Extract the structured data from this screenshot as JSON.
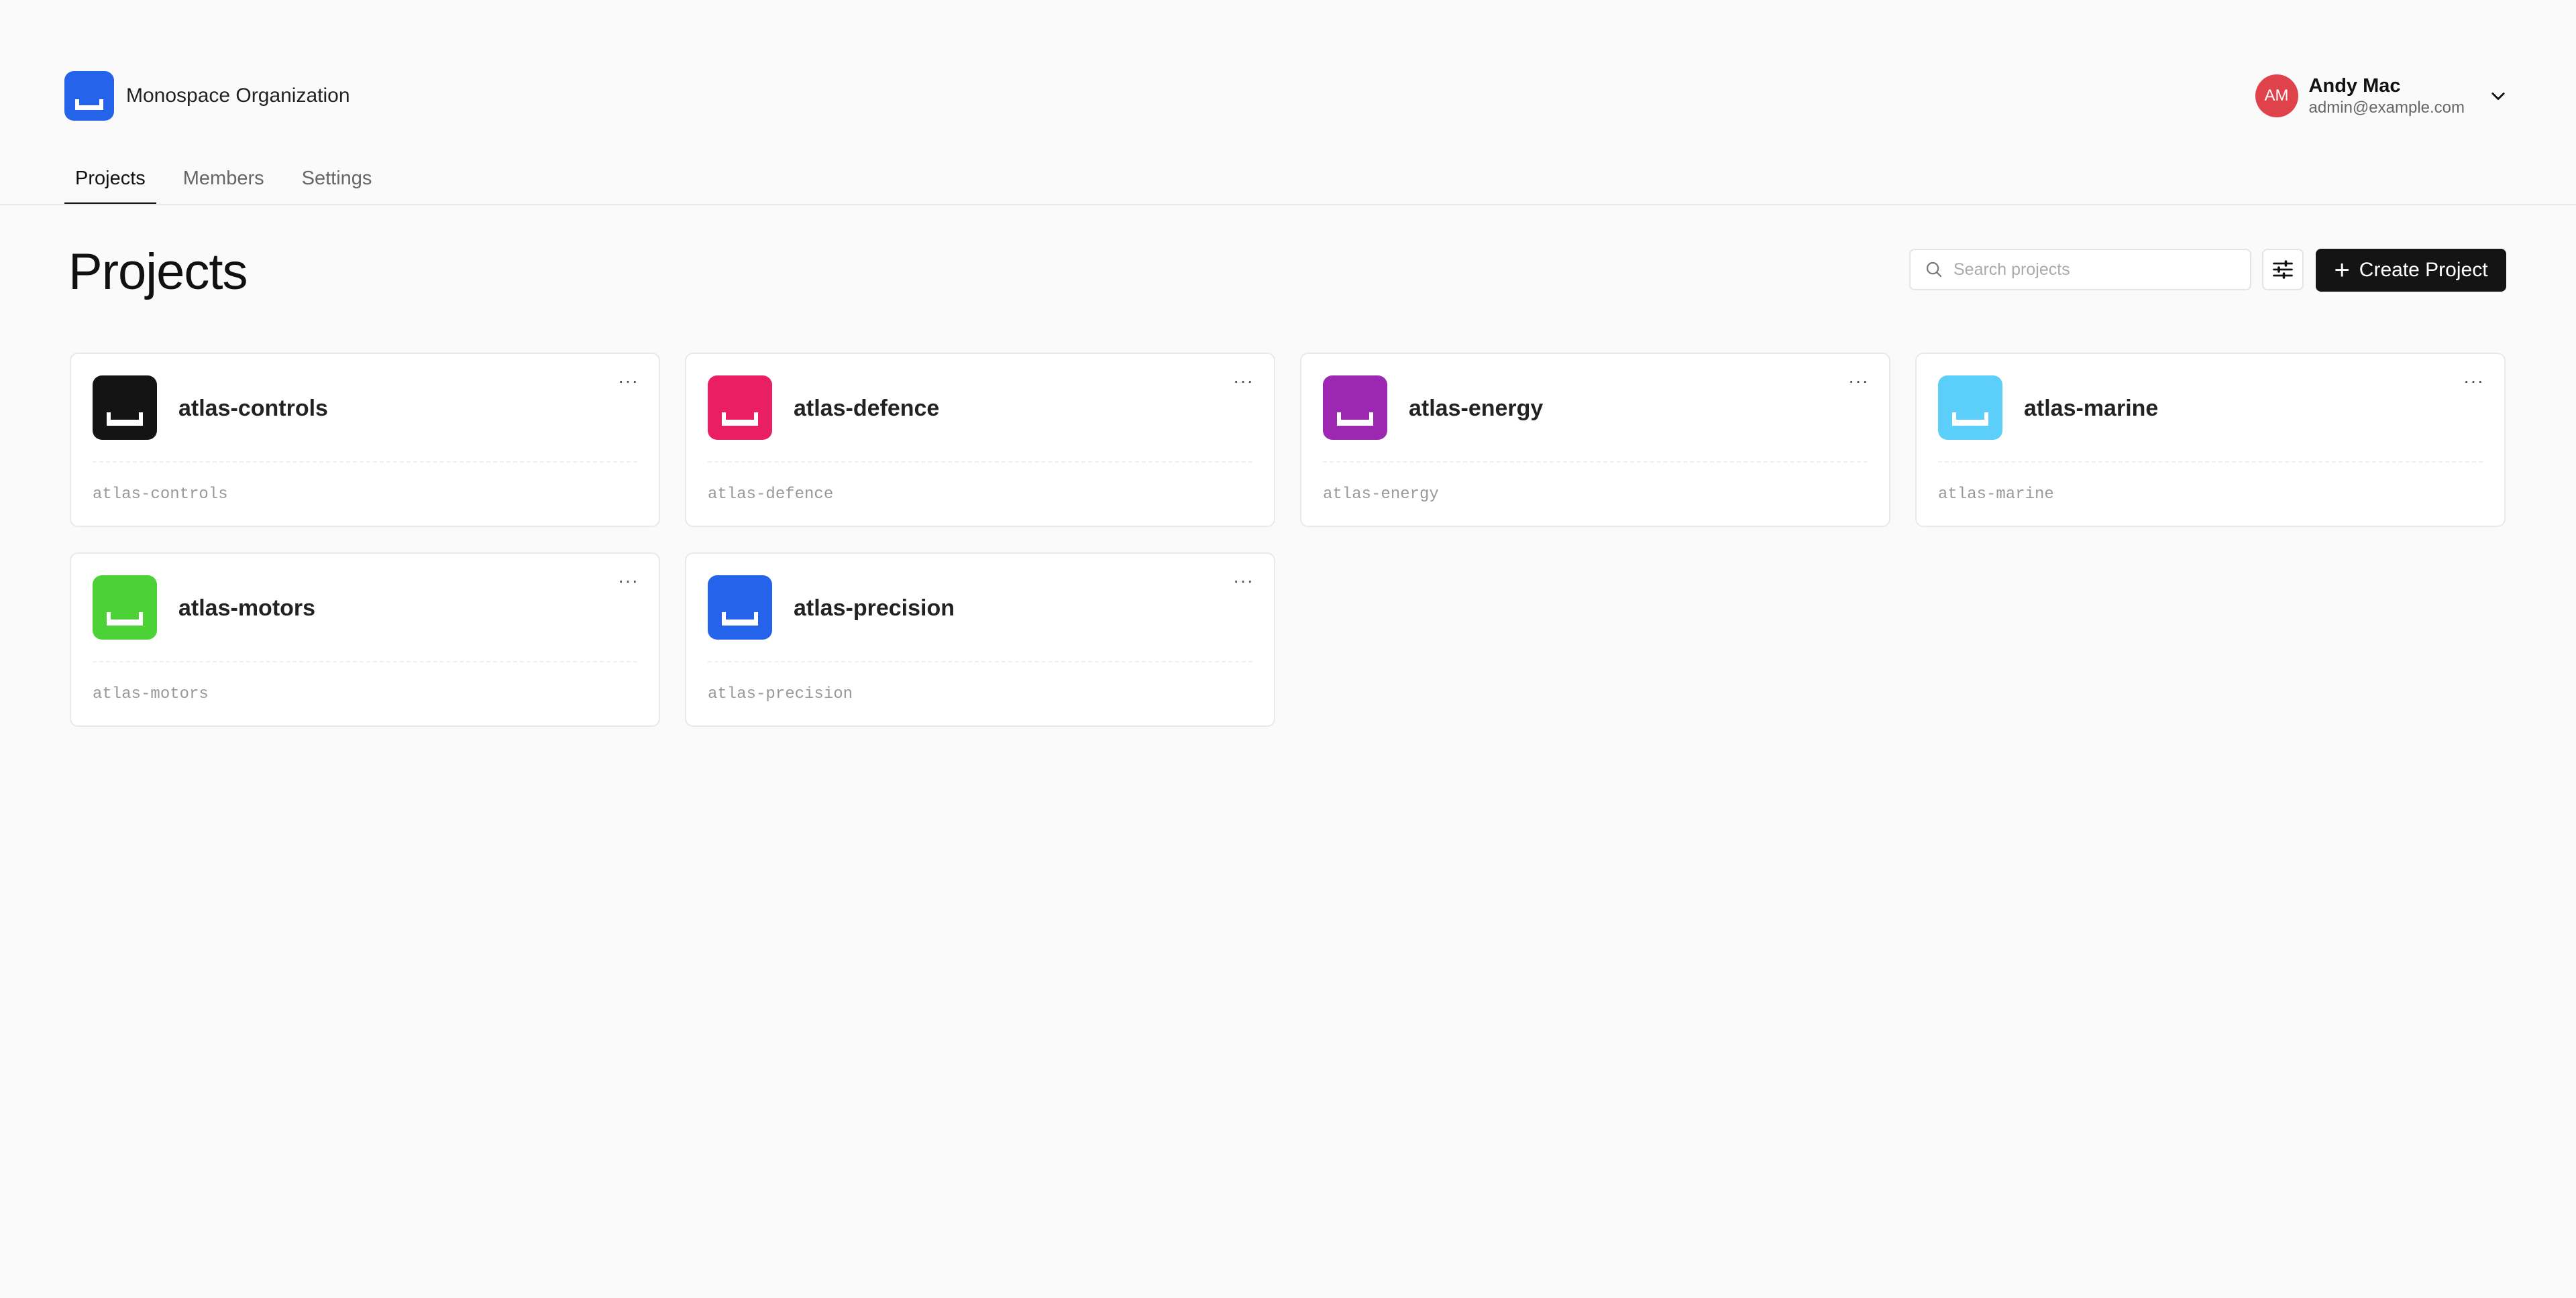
{
  "org": {
    "name": "Monospace Organization",
    "logo_color": "#2563eb",
    "logo_icon": "bracket-logo-icon"
  },
  "user": {
    "initials": "AM",
    "name": "Andy Mac",
    "email": "admin@example.com",
    "avatar_color": "#e0424b"
  },
  "tabs": [
    {
      "label": "Projects",
      "active": true
    },
    {
      "label": "Members",
      "active": false
    },
    {
      "label": "Settings",
      "active": false
    }
  ],
  "page": {
    "title": "Projects"
  },
  "search": {
    "placeholder": "Search projects",
    "value": ""
  },
  "toolbar": {
    "filter_icon": "sliders-icon",
    "create_label": "Create Project",
    "create_icon": "plus-icon"
  },
  "projects": [
    {
      "name": "atlas-controls",
      "slug": "atlas-controls",
      "color": "#141414"
    },
    {
      "name": "atlas-defence",
      "slug": "atlas-defence",
      "color": "#e91e63"
    },
    {
      "name": "atlas-energy",
      "slug": "atlas-energy",
      "color": "#9c27b0"
    },
    {
      "name": "atlas-marine",
      "slug": "atlas-marine",
      "color": "#5bcefa"
    },
    {
      "name": "atlas-motors",
      "slug": "atlas-motors",
      "color": "#4cd137"
    },
    {
      "name": "atlas-precision",
      "slug": "atlas-precision",
      "color": "#2563eb"
    }
  ],
  "card_menu_label": "···"
}
